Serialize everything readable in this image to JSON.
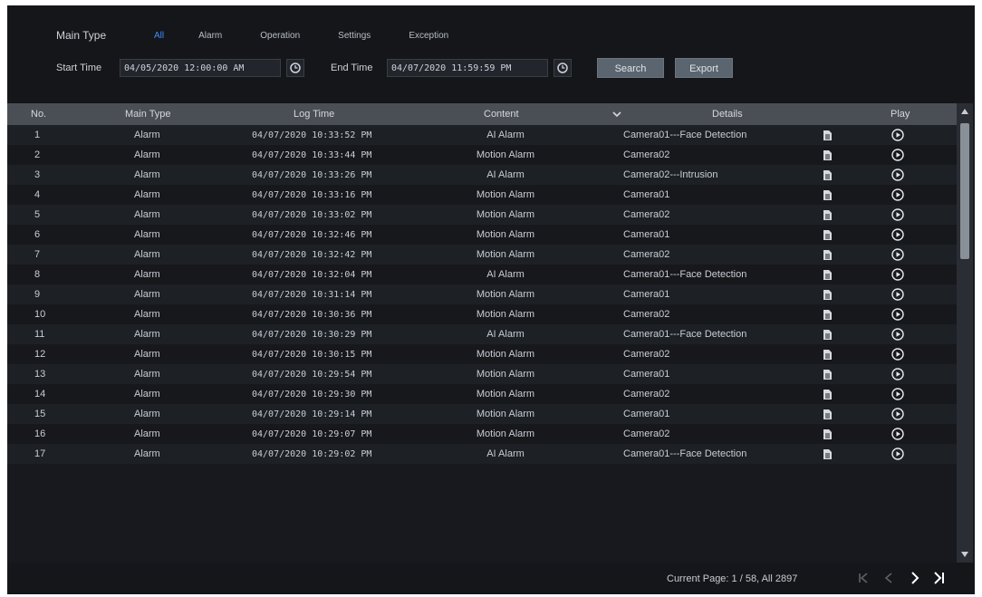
{
  "filters": {
    "main_type_label": "Main Type",
    "types": [
      "All",
      "Alarm",
      "Operation",
      "Settings",
      "Exception"
    ],
    "active_type": "All",
    "start_time_label": "Start Time",
    "start_time_value": "04/05/2020 12:00:00 AM",
    "end_time_label": "End Time",
    "end_time_value": "04/07/2020 11:59:59 PM",
    "search_label": "Search",
    "export_label": "Export"
  },
  "table": {
    "headers": {
      "no": "No.",
      "main_type": "Main Type",
      "log_time": "Log Time",
      "content": "Content",
      "details": "Details",
      "play": "Play"
    },
    "rows": [
      {
        "no": "1",
        "type": "Alarm",
        "time": "04/07/2020 10:33:52 PM",
        "content": "AI Alarm",
        "details": "Camera01---Face Detection"
      },
      {
        "no": "2",
        "type": "Alarm",
        "time": "04/07/2020 10:33:44 PM",
        "content": "Motion Alarm",
        "details": "Camera02"
      },
      {
        "no": "3",
        "type": "Alarm",
        "time": "04/07/2020 10:33:26 PM",
        "content": "AI Alarm",
        "details": "Camera02---Intrusion"
      },
      {
        "no": "4",
        "type": "Alarm",
        "time": "04/07/2020 10:33:16 PM",
        "content": "Motion Alarm",
        "details": "Camera01"
      },
      {
        "no": "5",
        "type": "Alarm",
        "time": "04/07/2020 10:33:02 PM",
        "content": "Motion Alarm",
        "details": "Camera02"
      },
      {
        "no": "6",
        "type": "Alarm",
        "time": "04/07/2020 10:32:46 PM",
        "content": "Motion Alarm",
        "details": "Camera01"
      },
      {
        "no": "7",
        "type": "Alarm",
        "time": "04/07/2020 10:32:42 PM",
        "content": "Motion Alarm",
        "details": "Camera02"
      },
      {
        "no": "8",
        "type": "Alarm",
        "time": "04/07/2020 10:32:04 PM",
        "content": "AI Alarm",
        "details": "Camera01---Face Detection"
      },
      {
        "no": "9",
        "type": "Alarm",
        "time": "04/07/2020 10:31:14 PM",
        "content": "Motion Alarm",
        "details": "Camera01"
      },
      {
        "no": "10",
        "type": "Alarm",
        "time": "04/07/2020 10:30:36 PM",
        "content": "Motion Alarm",
        "details": "Camera02"
      },
      {
        "no": "11",
        "type": "Alarm",
        "time": "04/07/2020 10:30:29 PM",
        "content": "AI Alarm",
        "details": "Camera01---Face Detection"
      },
      {
        "no": "12",
        "type": "Alarm",
        "time": "04/07/2020 10:30:15 PM",
        "content": "Motion Alarm",
        "details": "Camera02"
      },
      {
        "no": "13",
        "type": "Alarm",
        "time": "04/07/2020 10:29:54 PM",
        "content": "Motion Alarm",
        "details": "Camera01"
      },
      {
        "no": "14",
        "type": "Alarm",
        "time": "04/07/2020 10:29:30 PM",
        "content": "Motion Alarm",
        "details": "Camera02"
      },
      {
        "no": "15",
        "type": "Alarm",
        "time": "04/07/2020 10:29:14 PM",
        "content": "Motion Alarm",
        "details": "Camera01"
      },
      {
        "no": "16",
        "type": "Alarm",
        "time": "04/07/2020 10:29:07 PM",
        "content": "Motion Alarm",
        "details": "Camera02"
      },
      {
        "no": "17",
        "type": "Alarm",
        "time": "04/07/2020 10:29:02 PM",
        "content": "AI Alarm",
        "details": "Camera01---Face Detection"
      }
    ]
  },
  "footer": {
    "page_info": "Current Page: 1 / 58, All 2897"
  },
  "icons": {
    "clock": "clock-icon",
    "doc": "document-icon",
    "play": "play-circle-icon",
    "first": "first-page-icon",
    "prev": "prev-page-icon",
    "next": "next-page-icon",
    "last": "last-page-icon"
  },
  "colors": {
    "accent": "#3f8cff",
    "background": "#17191f",
    "header": "#4a4f56",
    "button": "#5b6570"
  }
}
